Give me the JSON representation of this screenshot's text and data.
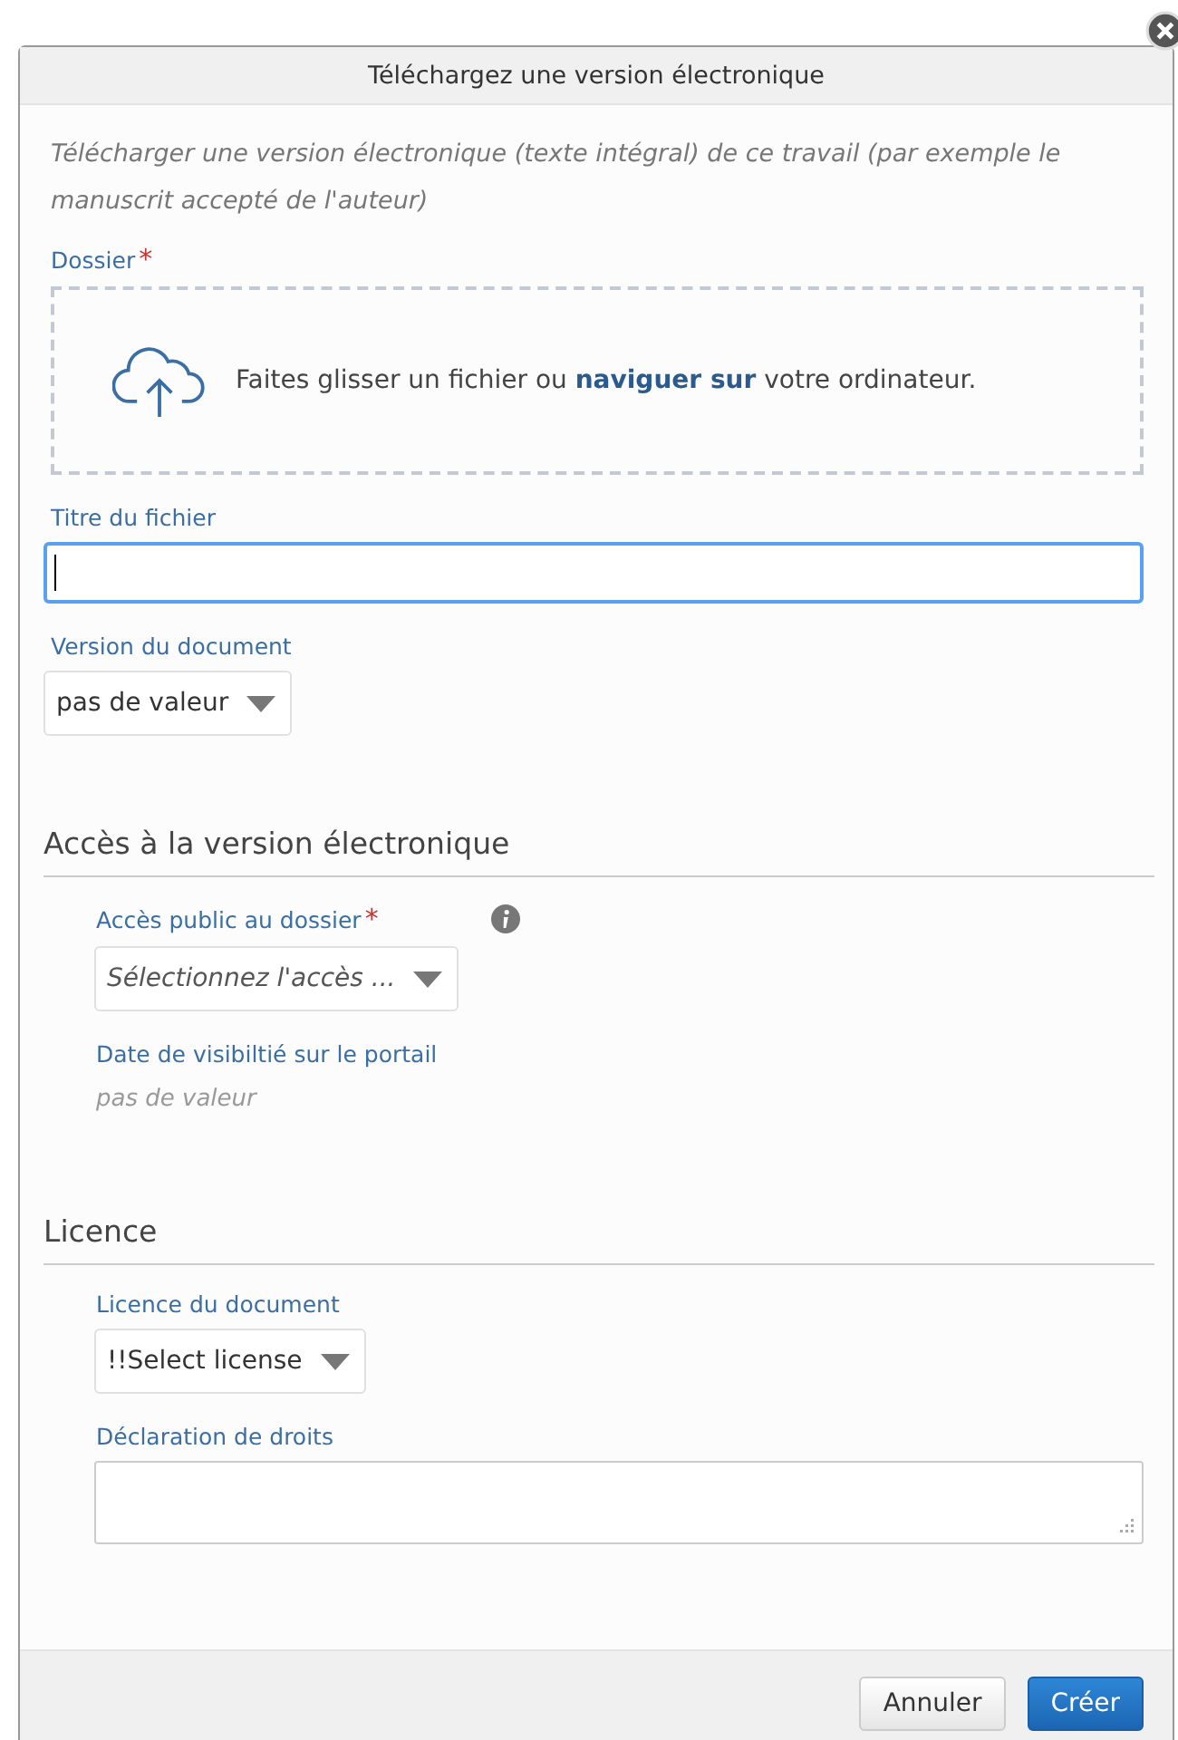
{
  "dialog": {
    "title": "Téléchargez une version électronique",
    "closable": true
  },
  "intro": "Télécharger une version électronique (texte intégral) de ce travail (par exemple le manuscrit accepté de l'auteur)",
  "file_drop": {
    "label": "Dossier",
    "required_mark": "*",
    "text_before": "Faites glisser un fichier ou ",
    "link": "naviguer sur",
    "text_after": " votre ordinateur."
  },
  "top_fields": [
    {
      "kind": "text",
      "label": "Titre du fichier",
      "focused": true
    },
    {
      "kind": "select",
      "label": "Version du document",
      "value": "pas de valeur",
      "italic": false
    }
  ],
  "sections": [
    {
      "heading": "Accès à la version électronique",
      "fields": [
        {
          "kind": "select",
          "label": "Accès public au dossier",
          "required_mark": "*",
          "info": true,
          "value": "Sélectionnez l'accès ...",
          "italic": true
        },
        {
          "kind": "readonly",
          "label": "Date de visibiltié sur le portail",
          "value": "pas de valeur"
        }
      ]
    },
    {
      "heading": "Licence",
      "fields": [
        {
          "kind": "select",
          "label": "Licence du document",
          "value": "!!Select license",
          "italic": false
        },
        {
          "kind": "textarea",
          "label": "Déclaration de droits"
        }
      ]
    }
  ],
  "buttons": [
    {
      "label": "Annuler",
      "kind": "secondary"
    },
    {
      "label": "Créer",
      "kind": "primary"
    }
  ]
}
